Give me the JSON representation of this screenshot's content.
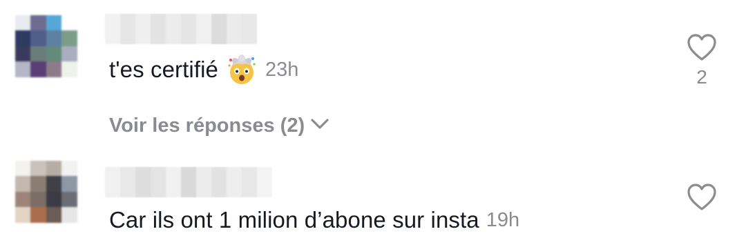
{
  "comments": [
    {
      "text": "t'es certifié",
      "emoji": "exploding-head",
      "timestamp": "23h",
      "likes": "2",
      "view_replies_label": "Voir les réponses (2)"
    },
    {
      "text": "Car ils ont 1 milion d’abone sur insta",
      "timestamp": "19h",
      "likes": ""
    }
  ],
  "colors": {
    "text": "#161823",
    "muted": "#8a8b91",
    "icon": "#8a8b91"
  }
}
